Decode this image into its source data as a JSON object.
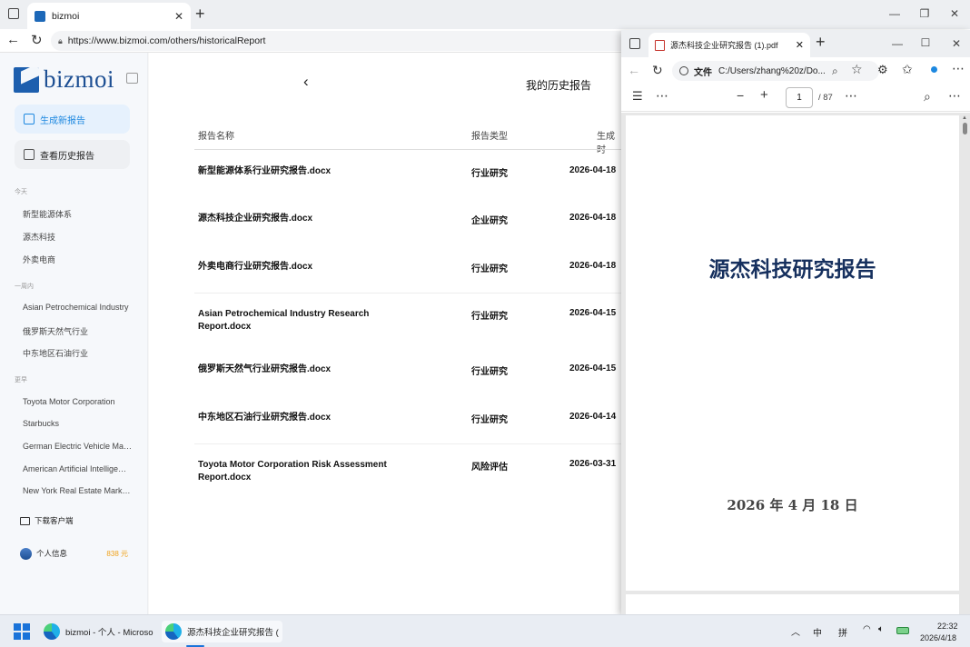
{
  "browser": {
    "tab_title": "bizmoi",
    "url": "https://www.bizmoi.com/others/historicalReport"
  },
  "sidebar": {
    "logo_text": "bizmoi",
    "btn_new": "生成新报告",
    "btn_history": "查看历史报告",
    "sections": [
      {
        "label": "今天",
        "items": [
          "新型能源体系",
          "源杰科技",
          "外卖电商"
        ]
      },
      {
        "label": "一周内",
        "items": [
          "Asian Petrochemical Industry",
          "俄罗斯天然气行业",
          "中东地区石油行业"
        ]
      },
      {
        "label": "更早",
        "items": [
          "Toyota Motor Corporation",
          "Starbucks",
          "German Electric Vehicle Ma…",
          "American Artificial Intellige…",
          "New York Real Estate Market…"
        ]
      }
    ],
    "download_client": "下载客户端",
    "profile_label": "个人信息",
    "balance": "838 元"
  },
  "main": {
    "page_title": "我的历史报告",
    "columns": [
      "报告名称",
      "报告类型",
      "生成时"
    ],
    "rows": [
      {
        "name": "新型能源体系行业研究报告.docx",
        "type": "行业研究",
        "date": "2026-04-18"
      },
      {
        "name": "源杰科技企业研究报告.docx",
        "type": "企业研究",
        "date": "2026-04-18"
      },
      {
        "name": "外卖电商行业研究报告.docx",
        "type": "行业研究",
        "date": "2026-04-18"
      },
      {
        "name": "Asian Petrochemical Industry Research Report.docx",
        "type": "行业研究",
        "date": "2026-04-15"
      },
      {
        "name": "俄罗斯天然气行业研究报告.docx",
        "type": "行业研究",
        "date": "2026-04-15"
      },
      {
        "name": "中东地区石油行业研究报告.docx",
        "type": "行业研究",
        "date": "2026-04-14"
      },
      {
        "name": "Toyota Motor Corporation Risk Assessment Report.docx",
        "type": "风险评估",
        "date": "2026-03-31"
      }
    ]
  },
  "pdf_window": {
    "tab_title": "源杰科技企业研究报告 (1).pdf",
    "file_label": "文件",
    "path": "C:/Users/zhang%20z/Do...",
    "page_current": "1",
    "page_total": "/ 87",
    "doc_title": "源杰科技研究报告",
    "doc_date": "2026 年 4 月 18 日"
  },
  "taskbar": {
    "app1": "bizmoi - 个人 - Microso",
    "app2": "源杰科技企业研究报告 (",
    "ime1": "中",
    "ime2": "拼",
    "time": "22:32",
    "date": "2026/4/18"
  },
  "colors": {
    "accent": "#1d88e0",
    "brand": "#1d4f93",
    "doc_title": "#16305e",
    "balance": "#f0a21a"
  }
}
